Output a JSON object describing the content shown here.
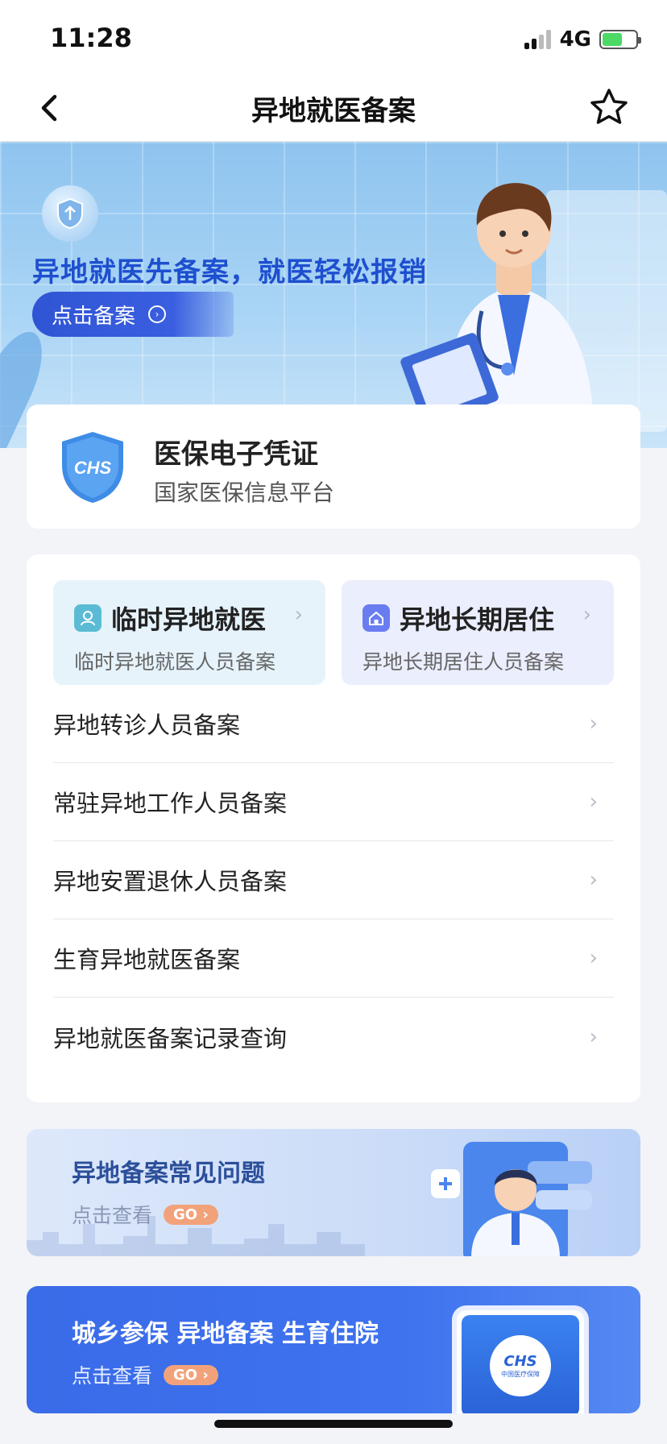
{
  "status_bar": {
    "time": "11:28",
    "network": "4G"
  },
  "nav": {
    "title": "异地就医备案"
  },
  "banner": {
    "headline": "异地就医先备案，就医轻松报销",
    "button_label": "点击备案"
  },
  "credential": {
    "logo_text": "CHS",
    "title": "医保电子凭证",
    "subtitle": "国家医保信息平台"
  },
  "quick_actions": [
    {
      "title": "临时异地就医",
      "subtitle": "临时异地就医人员备案",
      "icon": "nurse-icon",
      "color": "#5bbbd4"
    },
    {
      "title": "异地长期居住",
      "subtitle": "异地长期居住人员备案",
      "icon": "home-icon",
      "color": "#6a7df0"
    }
  ],
  "menu_items": [
    {
      "label": "异地转诊人员备案"
    },
    {
      "label": "常驻异地工作人员备案"
    },
    {
      "label": "异地安置退休人员备案"
    },
    {
      "label": "生育异地就医备案"
    },
    {
      "label": "异地就医备案记录查询"
    }
  ],
  "promos": [
    {
      "title": "异地备案常见问题",
      "link": "点击查看",
      "badge": "GO"
    },
    {
      "title": "城乡参保 异地备案 生育住院",
      "link": "点击查看",
      "badge": "GO"
    }
  ],
  "phone_logo": {
    "chs": "CHS",
    "text": "中国医疗保障"
  },
  "colors": {
    "accent": "#3a6be8",
    "banner_text": "#1e4fcf"
  }
}
